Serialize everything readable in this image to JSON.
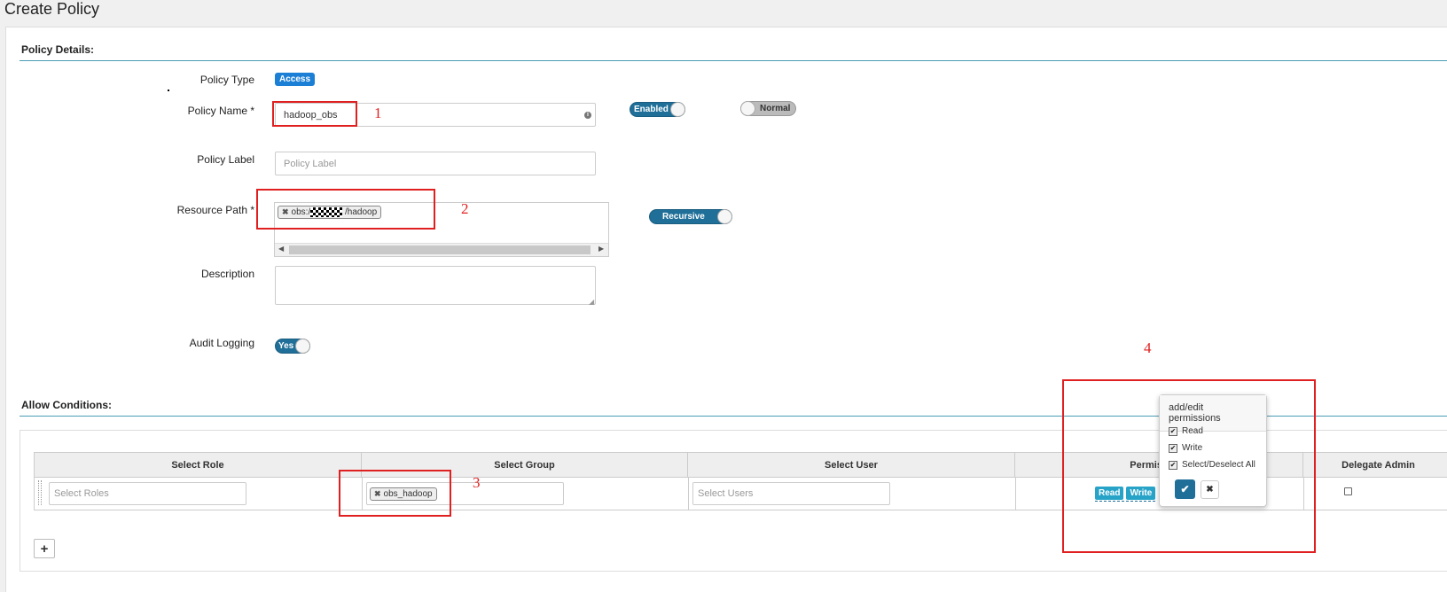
{
  "page": {
    "title": "Create Policy"
  },
  "policy_details": {
    "section_title": "Policy Details:",
    "policy_type": {
      "label": "Policy Type",
      "value": "Access"
    },
    "policy_name": {
      "label": "Policy Name *",
      "value": "hadoop_obs"
    },
    "enabled_toggle": {
      "label": "Enabled"
    },
    "normal_toggle": {
      "label": "Normal"
    },
    "policy_label": {
      "label": "Policy Label",
      "placeholder": "Policy Label"
    },
    "resource_path": {
      "label": "Resource Path *",
      "tag_prefix": "obs://",
      "tag_suffix": "/hadoop"
    },
    "recursive_toggle": {
      "label": "Recursive"
    },
    "description": {
      "label": "Description"
    },
    "audit_logging": {
      "label": "Audit Logging",
      "toggle": "Yes"
    }
  },
  "allow_conditions": {
    "section_title": "Allow Conditions:",
    "columns": [
      "Select Role",
      "Select Group",
      "Select User",
      "Permissions",
      "Delegate Admin"
    ],
    "row": {
      "role_placeholder": "Select Roles",
      "group_tag": "obs_hadoop",
      "user_placeholder": "Select Users",
      "permissions": [
        "Read",
        "Write"
      ]
    },
    "add_button": "+"
  },
  "permissions_popover": {
    "title": "add/edit permissions",
    "options": [
      {
        "label": "Read",
        "checked": true
      },
      {
        "label": "Write",
        "checked": true
      },
      {
        "label": "Select/Deselect All",
        "checked": true
      }
    ]
  },
  "annotations": {
    "n1": "1",
    "n2": "2",
    "n3": "3",
    "n4": "4"
  },
  "colors": {
    "accent": "#1f6f99",
    "badge": "#1b7fd6",
    "perm_badge": "#27a3c8",
    "annotation": "#e02020"
  }
}
